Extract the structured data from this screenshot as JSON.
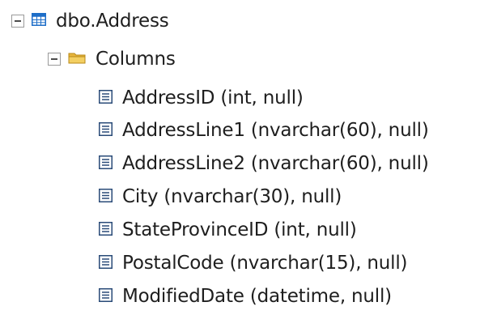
{
  "tree": {
    "table": {
      "label": "dbo.Address",
      "icon": "table-icon",
      "expanded": true
    },
    "folder": {
      "label": "Columns",
      "icon": "folder-icon",
      "expanded": true
    },
    "columns": [
      {
        "label": "AddressID (int, null)",
        "icon": "column-icon"
      },
      {
        "label": "AddressLine1 (nvarchar(60), null)",
        "icon": "column-icon"
      },
      {
        "label": "AddressLine2 (nvarchar(60), null)",
        "icon": "column-icon"
      },
      {
        "label": "City (nvarchar(30), null)",
        "icon": "column-icon"
      },
      {
        "label": "StateProvinceID (int, null)",
        "icon": "column-icon"
      },
      {
        "label": "PostalCode (nvarchar(15), null)",
        "icon": "column-icon"
      },
      {
        "label": "ModifiedDate (datetime, null)",
        "icon": "column-icon"
      }
    ]
  },
  "colors": {
    "text": "#1e1e1e",
    "table_icon_blue": "#1e6ec8",
    "folder_yellow": "#e8b53c",
    "column_icon_border": "#2a4b78"
  }
}
